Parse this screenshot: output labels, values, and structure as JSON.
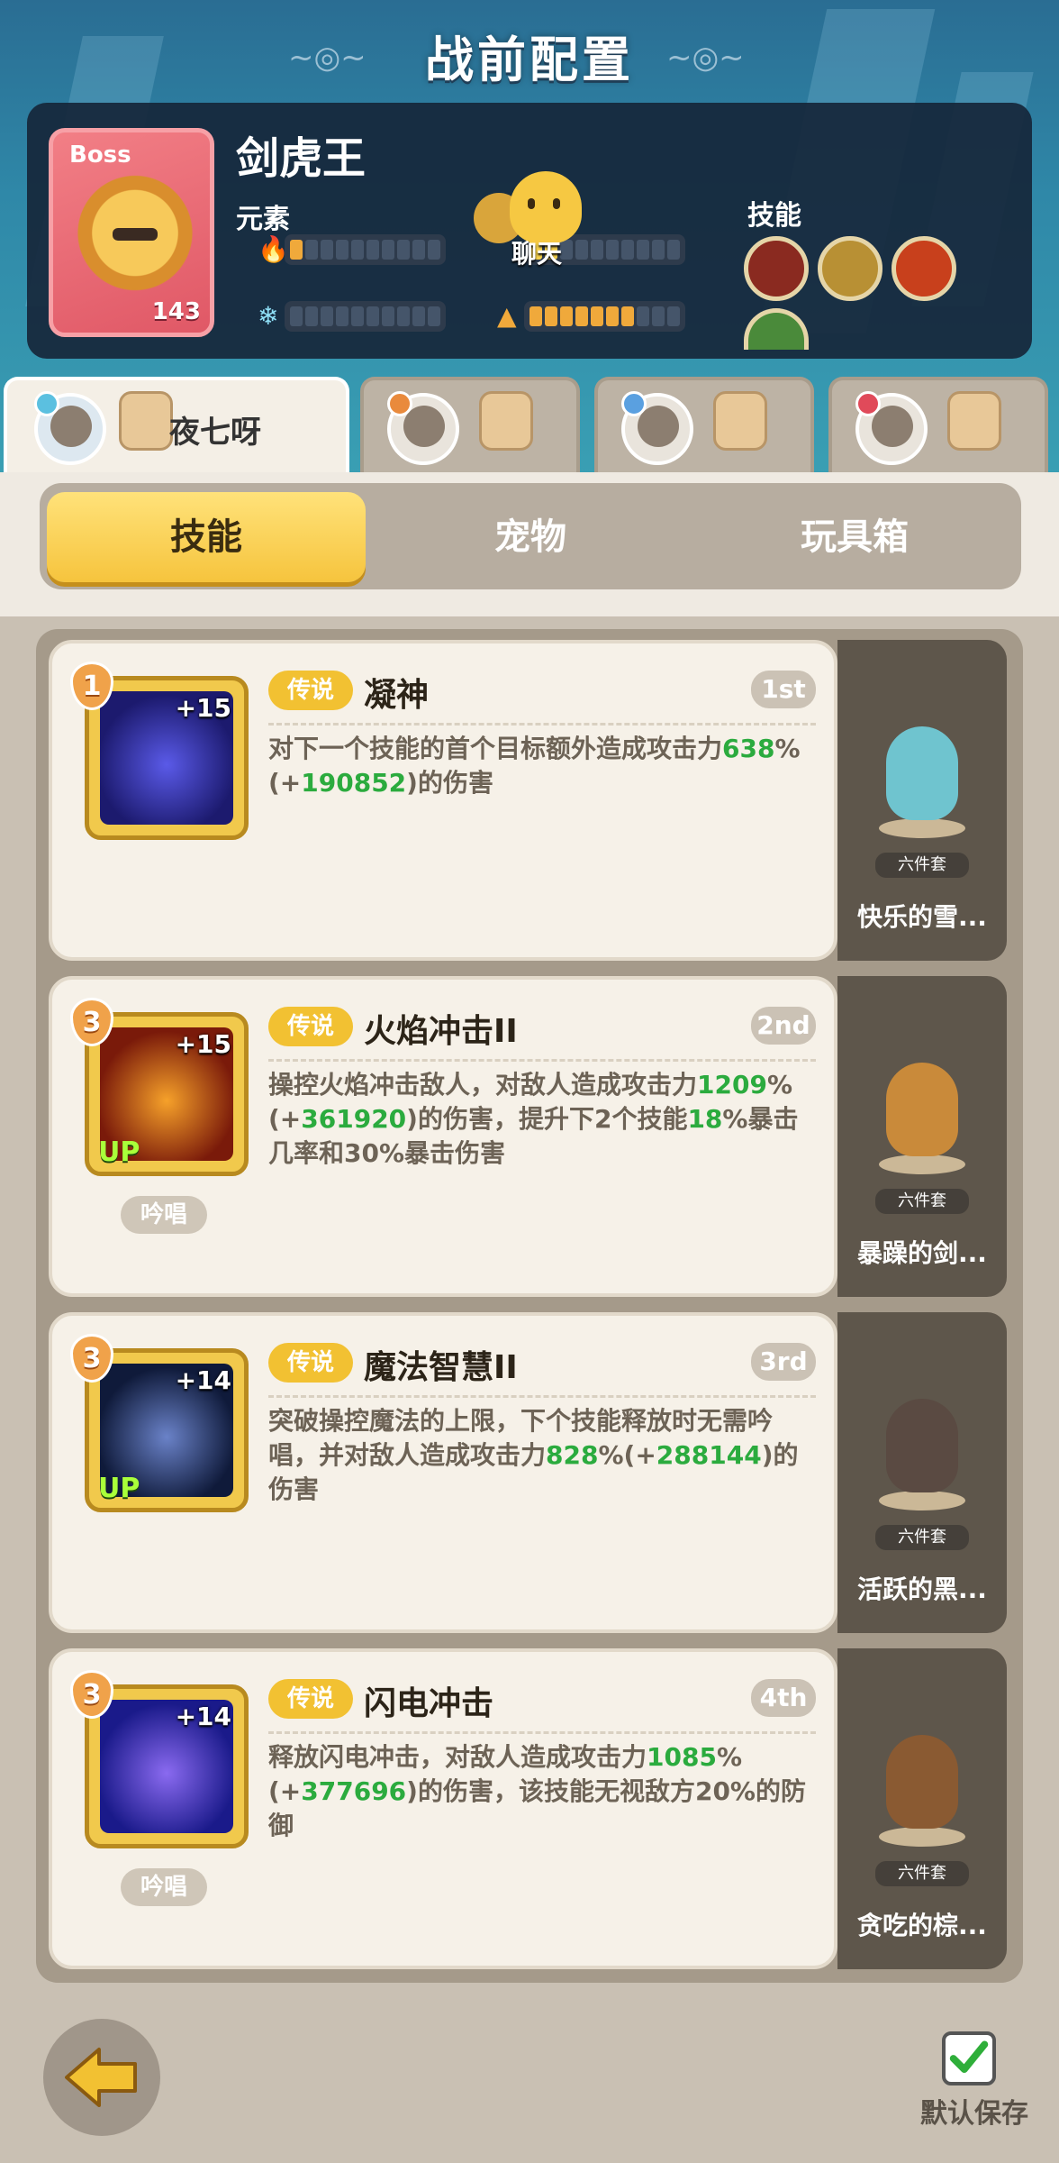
{
  "header": {
    "title": "战前配置"
  },
  "boss": {
    "tag": "Boss",
    "level": "143",
    "name": "剑虎王",
    "element_label": "元素",
    "skill_label": "技能",
    "chat_label": "聊天",
    "elements": [
      {
        "icon": "fire-icon",
        "level": 1,
        "max": 10
      },
      {
        "icon": "ice-icon",
        "level": 0,
        "max": 10
      },
      {
        "icon": "lightning-icon",
        "level": 2,
        "max": 10
      },
      {
        "icon": "earth-icon",
        "level": 7,
        "max": 10
      }
    ],
    "skills": [
      {
        "icon": "bite-skill-icon",
        "color": "#8a2a20"
      },
      {
        "icon": "beast-skill-icon",
        "color": "#b89034"
      },
      {
        "icon": "slash-skill-icon",
        "color": "#c8401c"
      },
      {
        "icon": "leaf-skill-icon",
        "color": "#4a8a3a"
      }
    ]
  },
  "players": [
    {
      "name": "夜七呀",
      "active": true
    },
    {
      "name": "",
      "active": false
    },
    {
      "name": "",
      "active": false
    },
    {
      "name": "",
      "active": false
    }
  ],
  "tabs": [
    {
      "label": "技能",
      "active": true
    },
    {
      "label": "宠物",
      "active": false
    },
    {
      "label": "玩具箱",
      "active": false
    }
  ],
  "skills": [
    {
      "level": "1",
      "plus": "+15",
      "up": false,
      "chant": "",
      "rarity": "传说",
      "name": "凝神",
      "order": "1st",
      "desc_parts": [
        "对下一个技能的首个目标额外造成攻击力",
        "638",
        "%(+",
        "190852",
        ")的伤害"
      ],
      "art_colors": [
        "#1c1a6e",
        "#5a5ae8"
      ],
      "pet": {
        "set": "六件套",
        "name": "快乐的雪...",
        "color": "#6fc4cf"
      }
    },
    {
      "level": "3",
      "plus": "+15",
      "up": true,
      "chant": "吟唱",
      "rarity": "传说",
      "name": "火焰冲击II",
      "order": "2nd",
      "desc_parts": [
        "操控火焰冲击敌人，对敌人造成攻击力",
        "1209",
        "%(+",
        "361920",
        ")的伤害，提升下2个技能",
        "18",
        "%暴击几率和30%暴击伤害"
      ],
      "art_colors": [
        "#7a1a0a",
        "#f6a12a"
      ],
      "pet": {
        "set": "六件套",
        "name": "暴躁的剑...",
        "color": "#c98a3a"
      }
    },
    {
      "level": "3",
      "plus": "+14",
      "up": true,
      "chant": "",
      "rarity": "传说",
      "name": "魔法智慧II",
      "order": "3rd",
      "desc_parts": [
        "突破操控魔法的上限，下个技能释放时无需吟唱，并对敌人造成攻击力",
        "828",
        "%(+",
        "288144",
        ")的伤害"
      ],
      "art_colors": [
        "#0f1a3a",
        "#6a82c8"
      ],
      "pet": {
        "set": "六件套",
        "name": "活跃的黑...",
        "color": "#5a4a42"
      }
    },
    {
      "level": "3",
      "plus": "+14",
      "up": false,
      "chant": "吟唱",
      "rarity": "传说",
      "name": "闪电冲击",
      "order": "4th",
      "desc_parts": [
        "释放闪电冲击，对敌人造成攻击力",
        "1085",
        "%(+",
        "377696",
        ")的伤害，该技能无视敌方20%的防御"
      ],
      "art_colors": [
        "#1a1a8a",
        "#8a6af0"
      ],
      "pet": {
        "set": "六件套",
        "name": "贪吃的棕...",
        "color": "#8a5a32"
      }
    }
  ],
  "footer": {
    "save_label": "默认保存"
  }
}
